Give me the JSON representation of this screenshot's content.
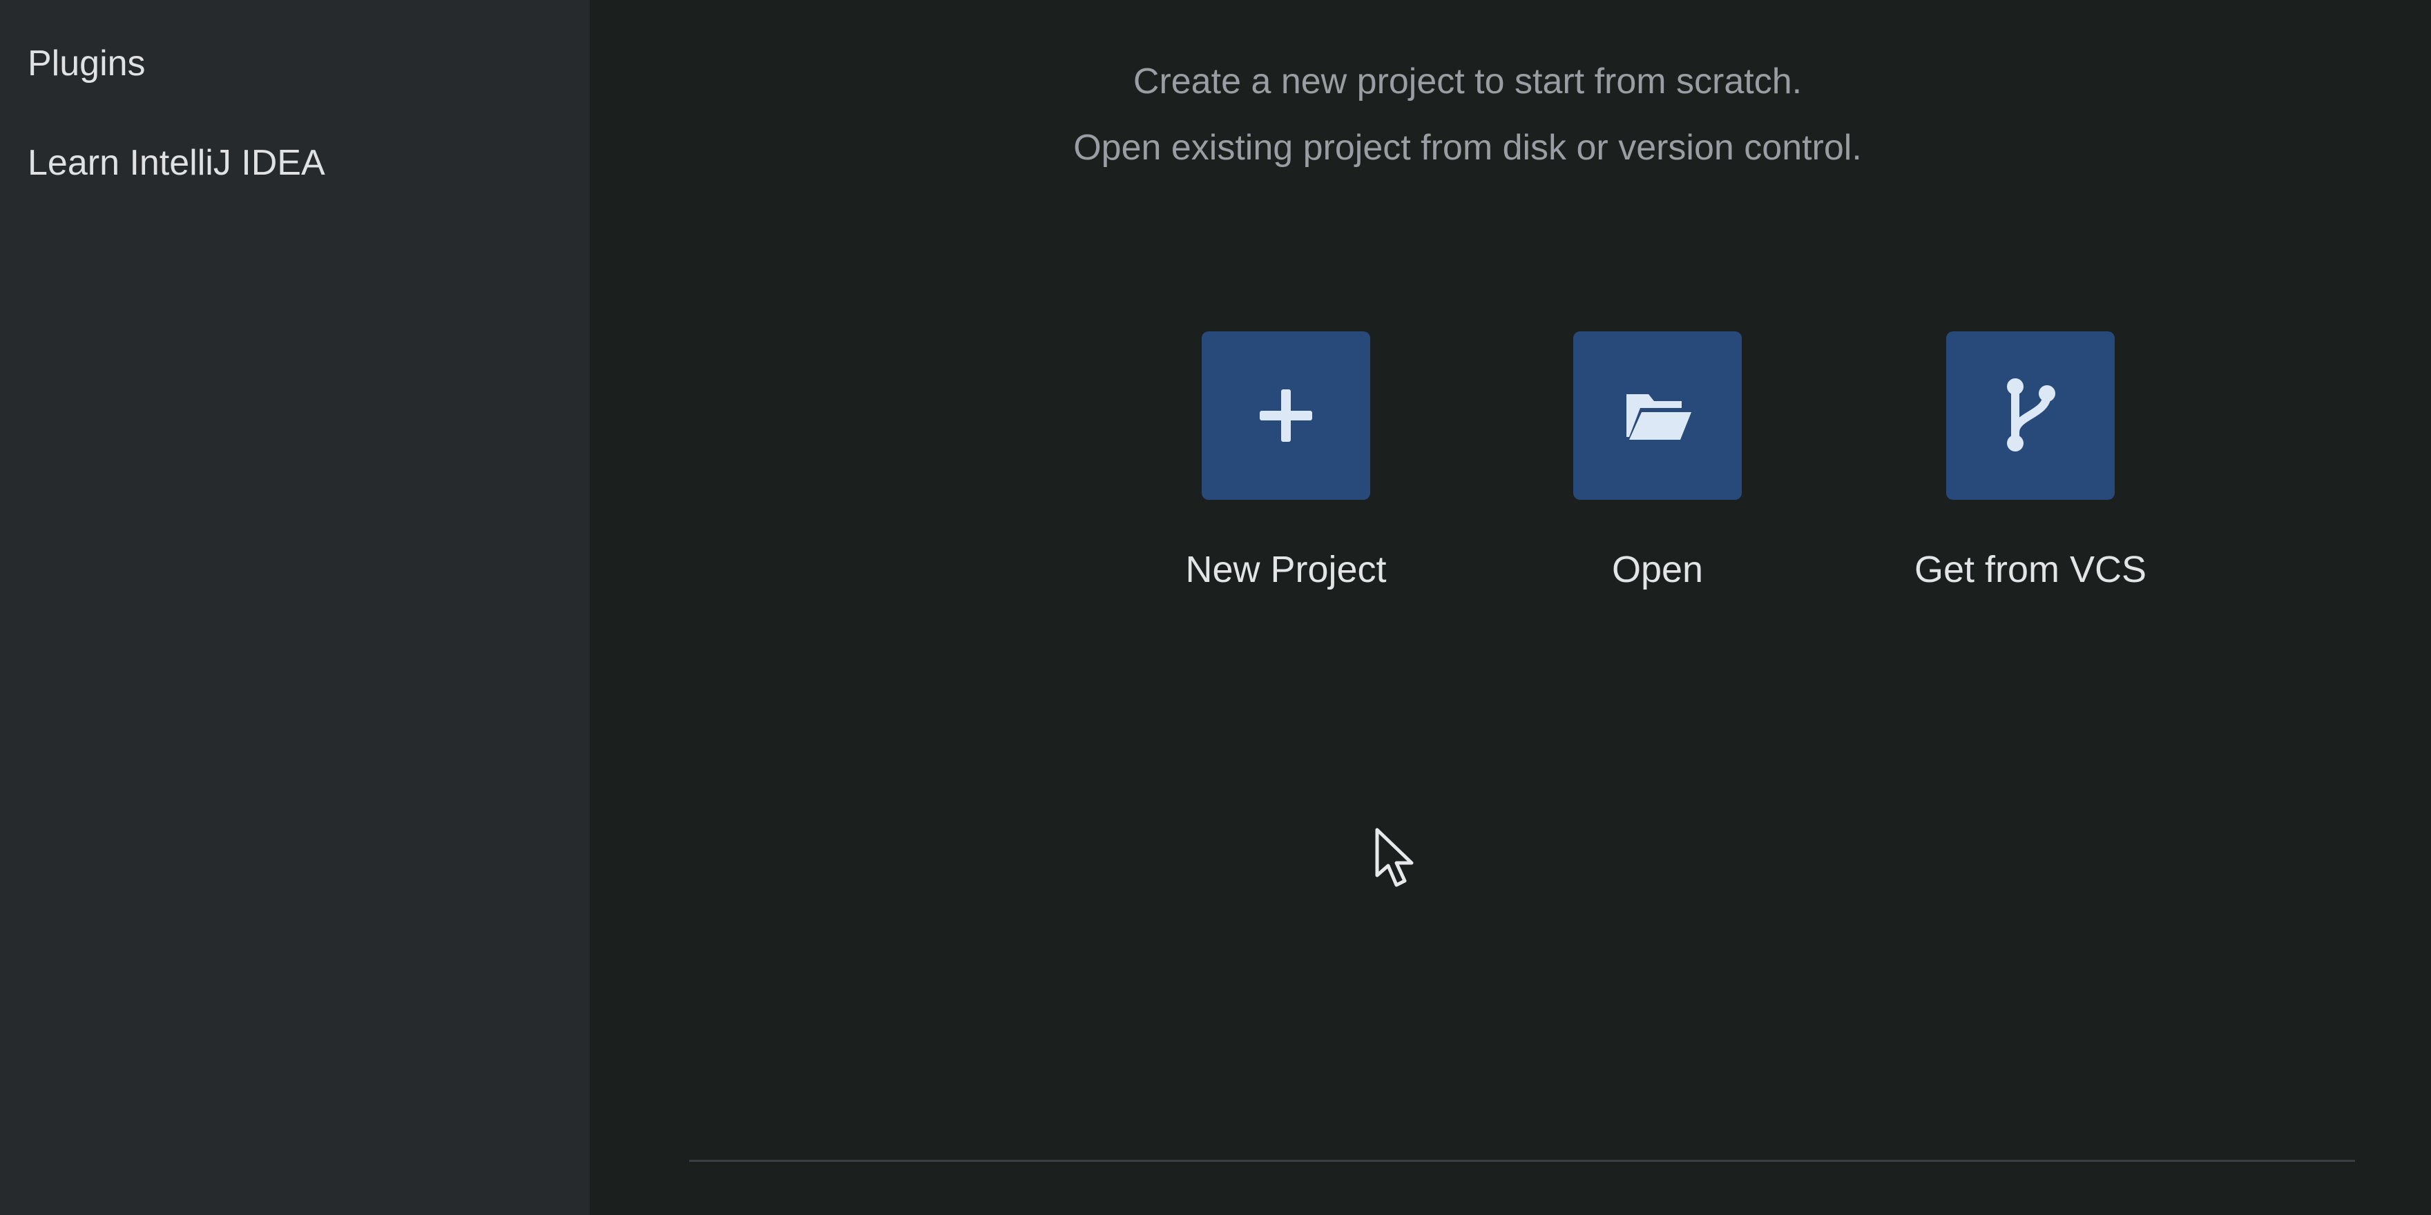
{
  "sidebar": {
    "items": [
      {
        "label": "Plugins"
      },
      {
        "label": "Learn IntelliJ IDEA"
      }
    ]
  },
  "main": {
    "subtitle_line1": "Create a new project to start from scratch.",
    "subtitle_line2": "Open existing project from disk or version control.",
    "actions": [
      {
        "label": "New Project",
        "icon": "plus-icon"
      },
      {
        "label": "Open",
        "icon": "folder-open-icon"
      },
      {
        "label": "Get from VCS",
        "icon": "vcs-branch-icon"
      }
    ]
  },
  "colors": {
    "sidebar_bg": "#262a2d",
    "main_bg": "#1b1f1e",
    "tile_bg": "#284a7a",
    "icon_fg": "#dce8f6"
  }
}
